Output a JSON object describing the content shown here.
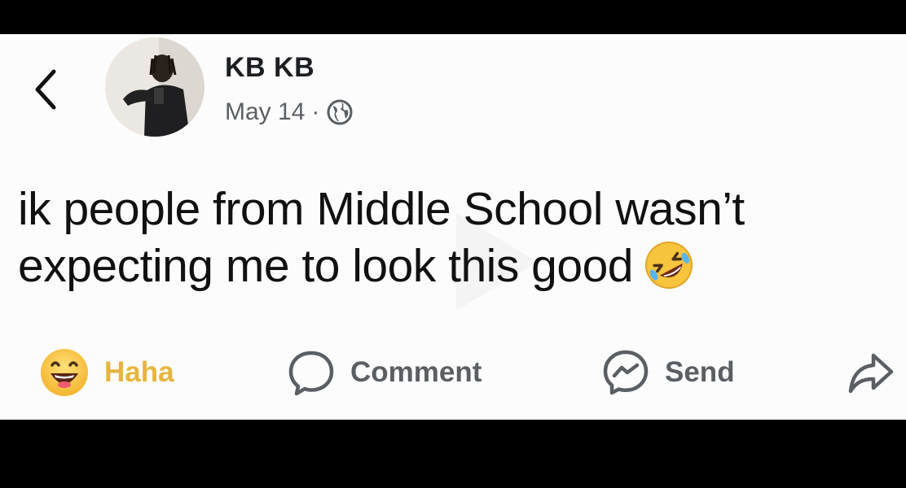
{
  "post": {
    "author": "KB KB",
    "date": "May 14",
    "separator": "·",
    "privacy_icon": "globe-icon",
    "text": "ik people from Middle School wasn’t expecting me to look this good",
    "text_emoji": "rolling-on-floor-laughing-emoji"
  },
  "actions": {
    "reaction_label": "Haha",
    "reaction_icon": "grinning-face-emoji",
    "comment_label": "Comment",
    "comment_icon": "comment-bubble-icon",
    "send_label": "Send",
    "send_icon": "messenger-icon",
    "share_icon": "share-arrow-icon"
  },
  "colors": {
    "background": "#fcfcfc",
    "text": "#111111",
    "muted": "#5b5e63",
    "haha": "#e7b53e"
  }
}
